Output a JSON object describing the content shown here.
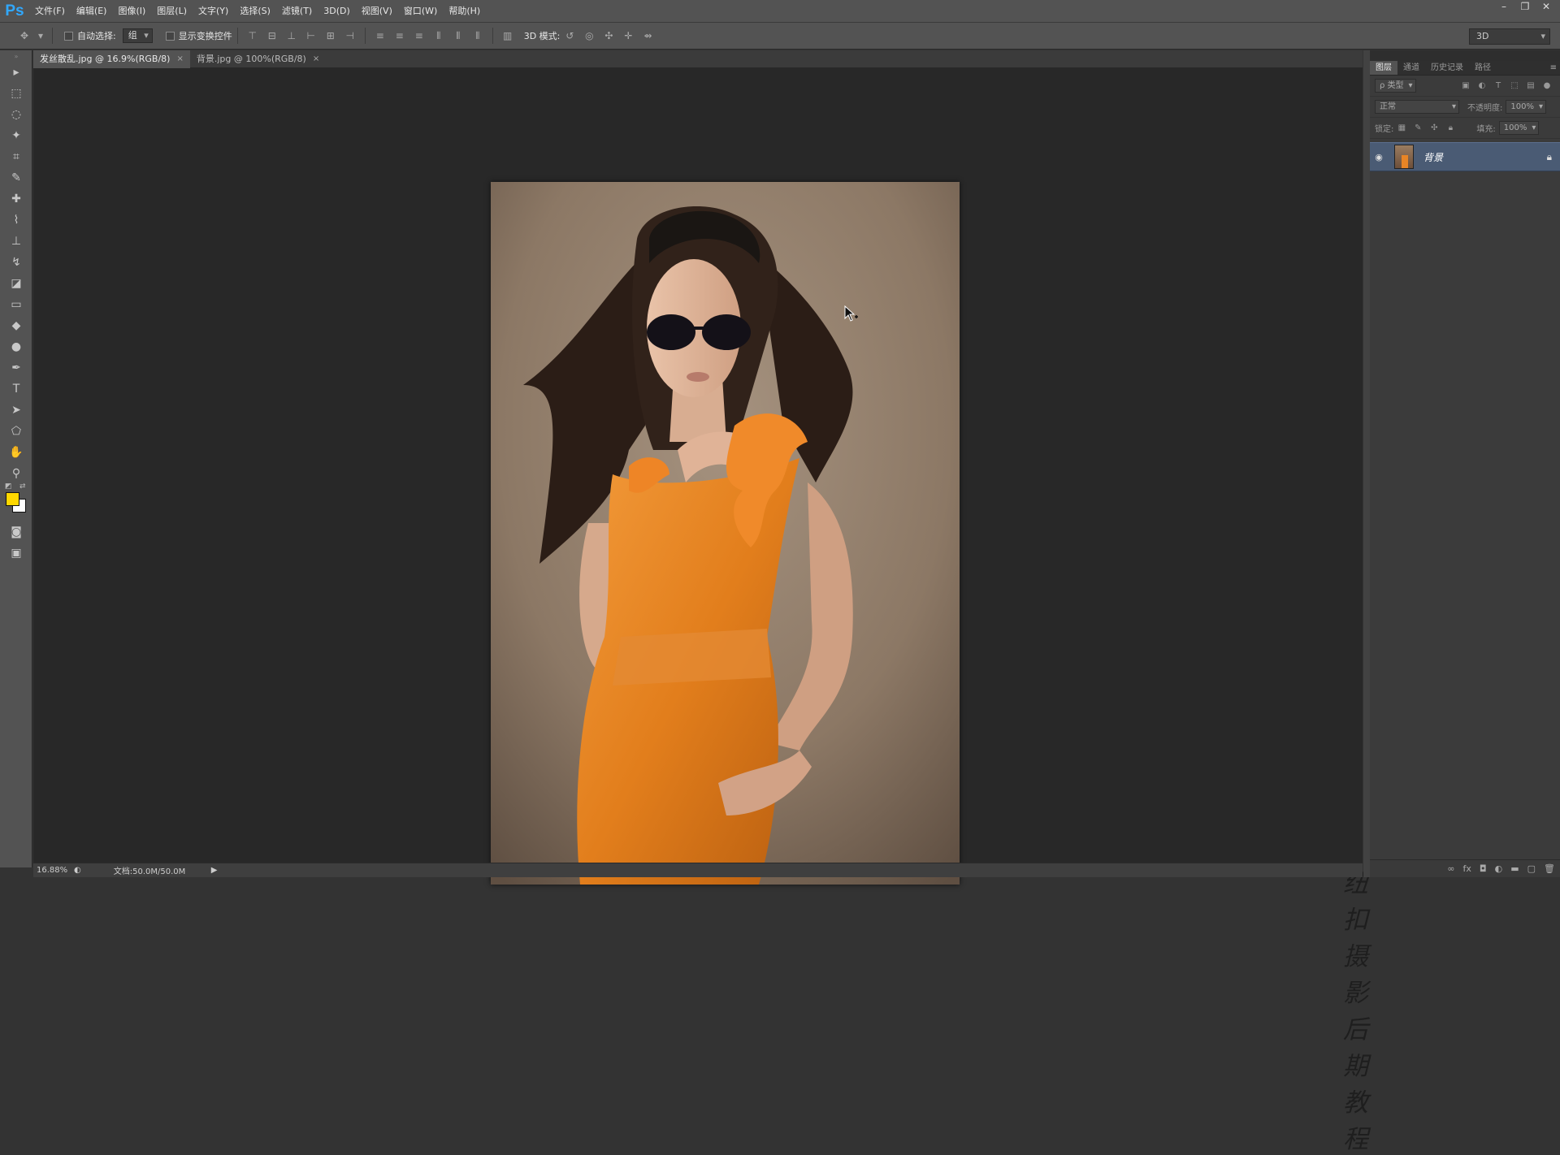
{
  "app": {
    "logo": "Ps"
  },
  "menu": [
    "文件(F)",
    "编辑(E)",
    "图像(I)",
    "图层(L)",
    "文字(Y)",
    "选择(S)",
    "滤镜(T)",
    "3D(D)",
    "视图(V)",
    "窗口(W)",
    "帮助(H)"
  ],
  "window_controls": {
    "minimize": "–",
    "restore": "❐",
    "close": "✕"
  },
  "options_bar": {
    "auto_select_label": "自动选择:",
    "auto_select_value": "组",
    "show_transform_label": "显示变换控件",
    "mode_3d_label": "3D 模式:",
    "workspace_value": "3D"
  },
  "tabs": [
    {
      "label": "发丝散乱.jpg @ 16.9%(RGB/8)",
      "close": "×"
    },
    {
      "label": "背景.jpg @ 100%(RGB/8)",
      "close": "×"
    }
  ],
  "colors": {
    "foreground": "#ffd800",
    "background": "#ffffff"
  },
  "status": {
    "zoom": "16.88%",
    "doc_info": "文档:50.0M/50.0M",
    "arrow": "▶"
  },
  "layers_panel": {
    "tabs": [
      "图层",
      "通道",
      "历史记录",
      "路径"
    ],
    "filter_label": "ρ 类型",
    "blend_mode": "正常",
    "opacity_label": "不透明度:",
    "opacity_value": "100%",
    "lock_label": "锁定:",
    "fill_label": "填充:",
    "fill_value": "100%",
    "layer": {
      "name": "背景"
    }
  },
  "watermark": "纽扣摄影后期教程"
}
